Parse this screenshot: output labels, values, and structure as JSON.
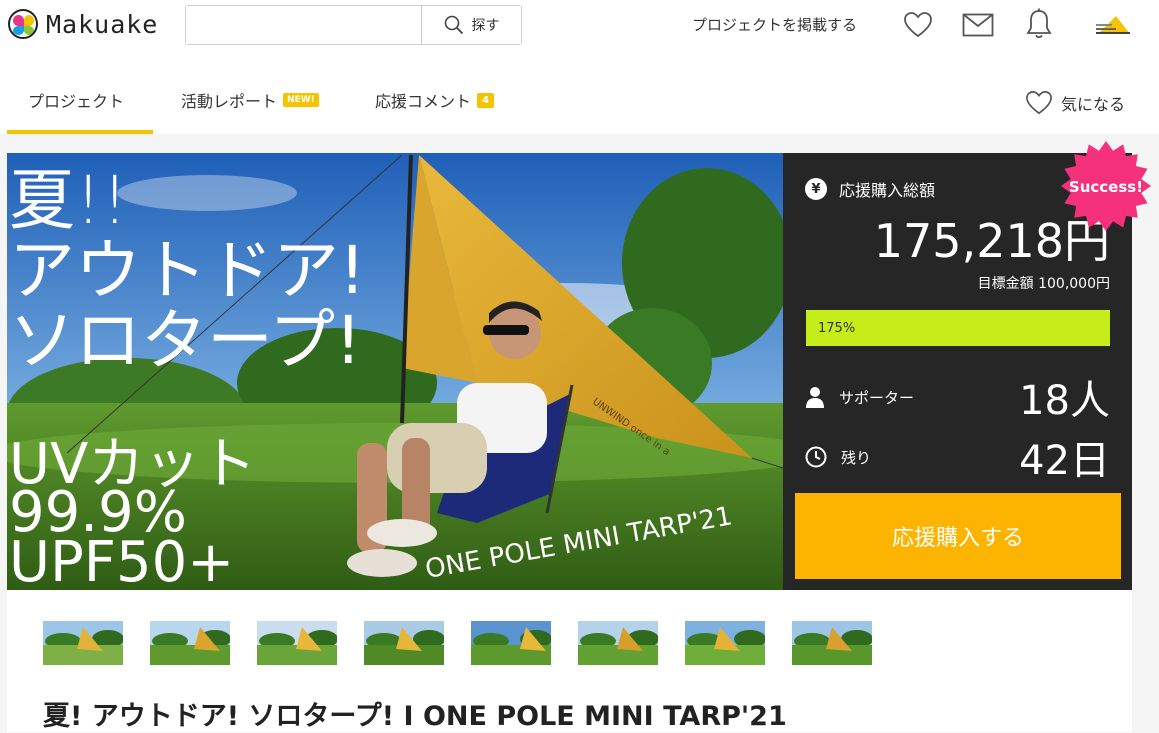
{
  "header": {
    "logo_text": "Makuake",
    "search_placeholder": "",
    "search_button": "探す",
    "post_project": "プロジェクトを掲載する",
    "icons": [
      "heart-icon",
      "mail-icon",
      "bell-icon",
      "avatar"
    ]
  },
  "tabs": {
    "items": [
      {
        "label": "プロジェクト",
        "active": true
      },
      {
        "label": "活動レポート",
        "badge": "NEW!"
      },
      {
        "label": "応援コメント",
        "badge": "4"
      }
    ],
    "favorite": "気になる"
  },
  "hero": {
    "overlay_line1": "夏!!",
    "overlay_line2": "アウトドア!",
    "overlay_line3": "ソロタープ!",
    "uv_line1": "UVカット",
    "uv_line2": "99.9%",
    "uv_line3": "UPF50+",
    "product_tag": "ONE POLE MINI TARP'21",
    "tarp_print": "UNWIND once in a"
  },
  "stats": {
    "funding_label": "応援購入総額",
    "yen_symbol": "¥",
    "amount": "175,218円",
    "target": "目標金額 100,000円",
    "progress_text": "175%",
    "progress_fraction": 1.0,
    "supporters_label": "サポーター",
    "supporters_value": "18人",
    "remaining_label": "残り",
    "remaining_value": "42日",
    "cta": "応援購入する",
    "success_badge": "Success!"
  },
  "colors": {
    "accent_yellow": "#f5c400",
    "cta_orange": "#fdb400",
    "progress_green": "#c6ec1a",
    "panel_dark": "#262626",
    "success_pink": "#f4317a"
  },
  "thumbnails_count": 8,
  "project_title": "夏! アウトドア! ソロタープ! I ONE POLE MINI TARP'21"
}
